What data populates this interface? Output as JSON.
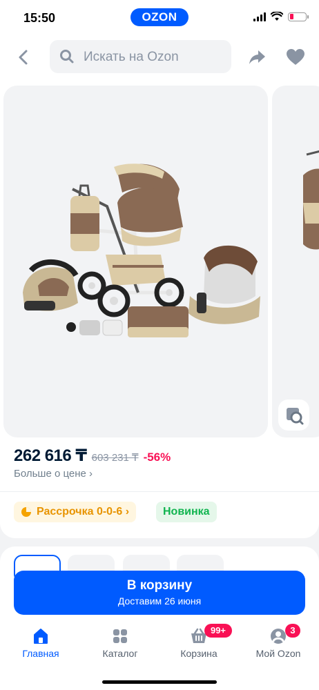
{
  "status_bar": {
    "time": "15:50",
    "brand": "OZON"
  },
  "header": {
    "search_placeholder": "Искать на Ozon"
  },
  "product": {
    "price": "262 616 ₸",
    "old_price": "603 231 ₸",
    "discount": "-56%",
    "more_about_price": "Больше о цене ›",
    "installment_label": "Рассрочка 0-0-6 ›",
    "new_badge": "Новинка"
  },
  "cta": {
    "title": "В корзину",
    "subtitle": "Доставим 26 июня"
  },
  "tabs": [
    {
      "label": "Главная",
      "icon": "home-icon",
      "active": true
    },
    {
      "label": "Каталог",
      "icon": "catalog-icon"
    },
    {
      "label": "Корзина",
      "icon": "cart-icon",
      "badge": "99+"
    },
    {
      "label": "Мой Ozon",
      "icon": "profile-icon",
      "badge": "3"
    }
  ],
  "colors": {
    "accent": "#005bff",
    "sale": "#f91155",
    "installment": "#e89400",
    "new": "#10b44f"
  }
}
